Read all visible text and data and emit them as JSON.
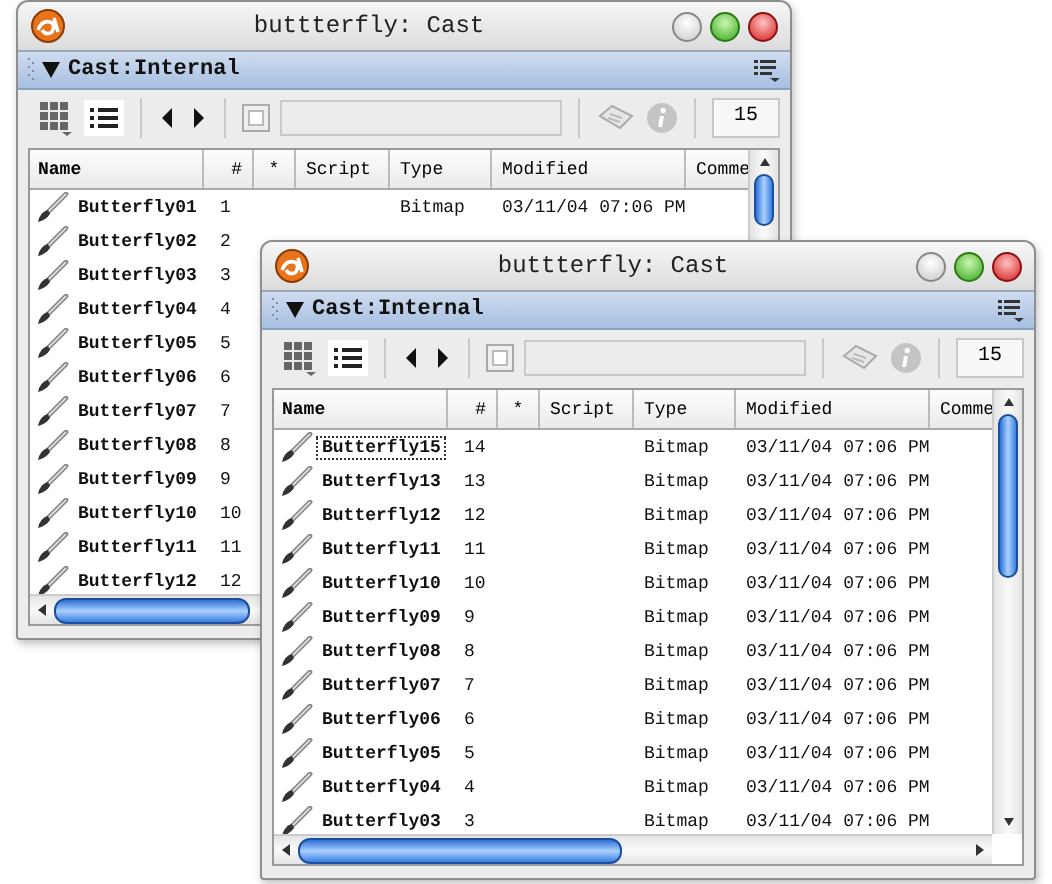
{
  "windows": [
    {
      "title": "buttterfly: Cast",
      "panel": "Cast:Internal",
      "count": "15",
      "columns": [
        "Name",
        "#",
        "*",
        "Script",
        "Type",
        "Modified",
        "Comme"
      ],
      "rows": [
        {
          "name": "Butterfly01",
          "number": "1",
          "type": "Bitmap",
          "modified": "03/11/04 07:06 PM",
          "selected": false
        },
        {
          "name": "Butterfly02",
          "number": "2",
          "selected": false
        },
        {
          "name": "Butterfly03",
          "number": "3",
          "selected": false
        },
        {
          "name": "Butterfly04",
          "number": "4",
          "selected": false
        },
        {
          "name": "Butterfly05",
          "number": "5",
          "selected": false
        },
        {
          "name": "Butterfly06",
          "number": "6",
          "selected": false
        },
        {
          "name": "Butterfly07",
          "number": "7",
          "selected": false
        },
        {
          "name": "Butterfly08",
          "number": "8",
          "selected": false
        },
        {
          "name": "Butterfly09",
          "number": "9",
          "selected": false
        },
        {
          "name": "Butterfly10",
          "number": "10",
          "selected": false
        },
        {
          "name": "Butterfly11",
          "number": "11",
          "selected": false
        },
        {
          "name": "Butterfly12",
          "number": "12",
          "selected": false
        }
      ]
    },
    {
      "title": "buttterfly: Cast",
      "panel": "Cast:Internal",
      "count": "15",
      "columns": [
        "Name",
        "#",
        "*",
        "Script",
        "Type",
        "Modified",
        "Comme"
      ],
      "rows": [
        {
          "name": "Butterfly15",
          "number": "14",
          "type": "Bitmap",
          "modified": "03/11/04 07:06 PM",
          "selected": true
        },
        {
          "name": "Butterfly13",
          "number": "13",
          "type": "Bitmap",
          "modified": "03/11/04 07:06 PM",
          "selected": false
        },
        {
          "name": "Butterfly12",
          "number": "12",
          "type": "Bitmap",
          "modified": "03/11/04 07:06 PM",
          "selected": false
        },
        {
          "name": "Butterfly11",
          "number": "11",
          "type": "Bitmap",
          "modified": "03/11/04 07:06 PM",
          "selected": false
        },
        {
          "name": "Butterfly10",
          "number": "10",
          "type": "Bitmap",
          "modified": "03/11/04 07:06 PM",
          "selected": false
        },
        {
          "name": "Butterfly09",
          "number": "9",
          "type": "Bitmap",
          "modified": "03/11/04 07:06 PM",
          "selected": false
        },
        {
          "name": "Butterfly08",
          "number": "8",
          "type": "Bitmap",
          "modified": "03/11/04 07:06 PM",
          "selected": false
        },
        {
          "name": "Butterfly07",
          "number": "7",
          "type": "Bitmap",
          "modified": "03/11/04 07:06 PM",
          "selected": false
        },
        {
          "name": "Butterfly06",
          "number": "6",
          "type": "Bitmap",
          "modified": "03/11/04 07:06 PM",
          "selected": false
        },
        {
          "name": "Butterfly05",
          "number": "5",
          "type": "Bitmap",
          "modified": "03/11/04 07:06 PM",
          "selected": false
        },
        {
          "name": "Butterfly04",
          "number": "4",
          "type": "Bitmap",
          "modified": "03/11/04 07:06 PM",
          "selected": false
        },
        {
          "name": "Butterfly03",
          "number": "3",
          "type": "Bitmap",
          "modified": "03/11/04 07:06 PM",
          "selected": false
        }
      ]
    }
  ]
}
